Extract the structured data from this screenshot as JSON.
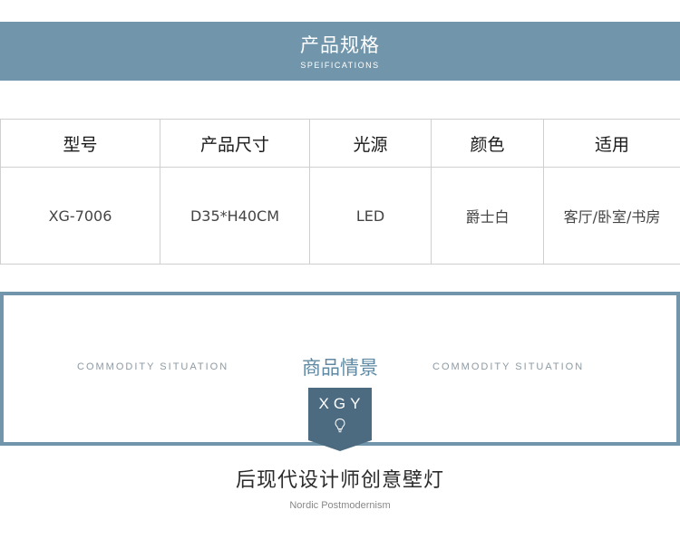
{
  "banner": {
    "title": "产品规格",
    "subtitle": "SPEIFICATIONS"
  },
  "specs": {
    "headers": [
      "型号",
      "产品尺寸",
      "光源",
      "颜色",
      "适用"
    ],
    "row": [
      "XG-7006",
      "D35*H40CM",
      "LED",
      "爵士白",
      "客厅/卧室/书房"
    ]
  },
  "scene": {
    "left_caption": "COMMODITY SITUATION",
    "title": "商品情景",
    "right_caption": "COMMODITY SITUATION",
    "badge_text": "XGY",
    "badge_icon": "lightbulb-icon"
  },
  "product": {
    "title": "后现代设计师创意壁灯",
    "subtitle": "Nordic Postmodernism"
  },
  "colors": {
    "banner": "#7196ab",
    "frame_border": "#7196ab",
    "badge": "#4d6b80",
    "scene_title": "#5f89a3"
  }
}
